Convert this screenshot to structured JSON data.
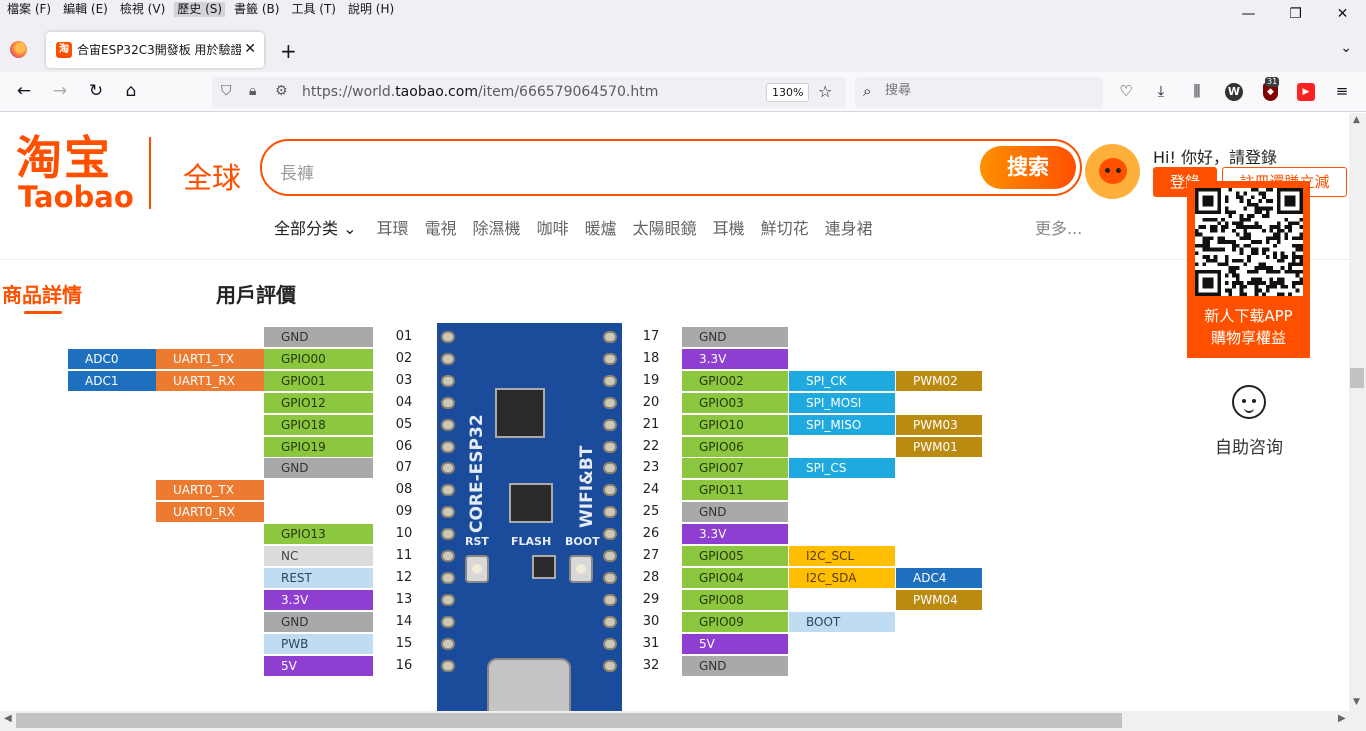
{
  "menubar": {
    "items": [
      "檔案 (F)",
      "編輯 (E)",
      "檢視 (V)",
      "歷史 (S)",
      "書籤 (B)",
      "工具 (T)",
      "說明 (H)"
    ],
    "active_index": 3,
    "window_controls": [
      "—",
      "❐",
      "✕"
    ]
  },
  "tab": {
    "title": "合宙ESP32C3開發板 用於驗證E",
    "favicon_text": "淘",
    "close": "✕"
  },
  "navbar": {
    "url_prefix": "https://world.",
    "url_domain": "taobao.com",
    "url_suffix": "/item/666579064570.htm",
    "zoom": "130%",
    "search_placeholder": "搜尋",
    "badge_count": "31",
    "w_label": "W"
  },
  "header": {
    "logo_cn": "淘宝",
    "logo_en": "Taobao",
    "global": "全球",
    "search_query": "長褲",
    "search_button": "搜索",
    "greeting": "Hi! 你好，請登錄",
    "login_button": "登錄",
    "register_button": "註冊還賺立減",
    "categories_all": "全部分类",
    "categories": [
      "耳環",
      "電視",
      "除濕機",
      "咖啡",
      "暖爐",
      "太陽眼鏡",
      "耳機",
      "鮮切花",
      "連身裙"
    ],
    "more": "更多..."
  },
  "qr_panel": {
    "line1": "新人下载APP",
    "line2": "購物享權益"
  },
  "product_tabs": {
    "detail": "商品詳情",
    "review": "用戶評價"
  },
  "service": {
    "label": "自助咨询"
  },
  "pinout": {
    "left_pins": [
      {
        "num": "01",
        "pin": "GND",
        "type": "gnd"
      },
      {
        "num": "02",
        "pin": "GPIO00",
        "type": "gpio",
        "f1": "UART1_TX",
        "f2": "ADC0"
      },
      {
        "num": "03",
        "pin": "GPIO01",
        "type": "gpio",
        "f1": "UART1_RX",
        "f2": "ADC1"
      },
      {
        "num": "04",
        "pin": "GPIO12",
        "type": "gpio"
      },
      {
        "num": "05",
        "pin": "GPIO18",
        "type": "gpio"
      },
      {
        "num": "06",
        "pin": "GPIO19",
        "type": "gpio"
      },
      {
        "num": "07",
        "pin": "GND",
        "type": "gnd"
      },
      {
        "num": "08",
        "pin": "",
        "type": "none",
        "f1": "UART0_TX"
      },
      {
        "num": "09",
        "pin": "",
        "type": "none",
        "f1": "UART0_RX"
      },
      {
        "num": "10",
        "pin": "GPIO13",
        "type": "gpio"
      },
      {
        "num": "11",
        "pin": "NC",
        "type": "nc"
      },
      {
        "num": "12",
        "pin": "REST",
        "type": "rest"
      },
      {
        "num": "13",
        "pin": "3.3V",
        "type": "33"
      },
      {
        "num": "14",
        "pin": "GND",
        "type": "gnd"
      },
      {
        "num": "15",
        "pin": "PWB",
        "type": "rest"
      },
      {
        "num": "16",
        "pin": "5V",
        "type": "5v"
      }
    ],
    "right_pins": [
      {
        "num": "17",
        "pin": "GND",
        "type": "gnd"
      },
      {
        "num": "18",
        "pin": "3.3V",
        "type": "33"
      },
      {
        "num": "19",
        "pin": "GPIO02",
        "type": "gpio",
        "f1": "SPI_CK",
        "f1type": "spi",
        "f2": "PWM02",
        "f2type": "pwm"
      },
      {
        "num": "20",
        "pin": "GPIO03",
        "type": "gpio",
        "f1": "SPI_MOSI",
        "f1type": "spi"
      },
      {
        "num": "21",
        "pin": "GPIO10",
        "type": "gpio",
        "f1": "SPI_MISO",
        "f1type": "spi",
        "f2": "PWM03",
        "f2type": "pwm"
      },
      {
        "num": "22",
        "pin": "GPIO06",
        "type": "gpio",
        "f2": "PWM01",
        "f2type": "pwm"
      },
      {
        "num": "23",
        "pin": "GPIO07",
        "type": "gpio",
        "f1": "SPI_CS",
        "f1type": "spi"
      },
      {
        "num": "24",
        "pin": "GPIO11",
        "type": "gpio"
      },
      {
        "num": "25",
        "pin": "GND",
        "type": "gnd"
      },
      {
        "num": "26",
        "pin": "3.3V",
        "type": "33"
      },
      {
        "num": "27",
        "pin": "GPIO05",
        "type": "gpio",
        "f1": "I2C_SCL",
        "f1type": "i2c"
      },
      {
        "num": "28",
        "pin": "GPIO04",
        "type": "gpio",
        "f1": "I2C_SDA",
        "f1type": "i2c",
        "f2": "ADC4",
        "f2type": "adc"
      },
      {
        "num": "29",
        "pin": "GPIO08",
        "type": "gpio",
        "f2": "PWM04",
        "f2type": "pwm"
      },
      {
        "num": "30",
        "pin": "GPIO09",
        "type": "gpio",
        "f1": "BOOT",
        "f1type": "boot"
      },
      {
        "num": "31",
        "pin": "5V",
        "type": "5v"
      },
      {
        "num": "32",
        "pin": "GND",
        "type": "gnd"
      }
    ],
    "board_text": {
      "vertical": "CORE-ESP32",
      "wifi": "WIFI&BT",
      "rst": "RST",
      "flash": "FLASH",
      "boot": "BOOT"
    }
  }
}
